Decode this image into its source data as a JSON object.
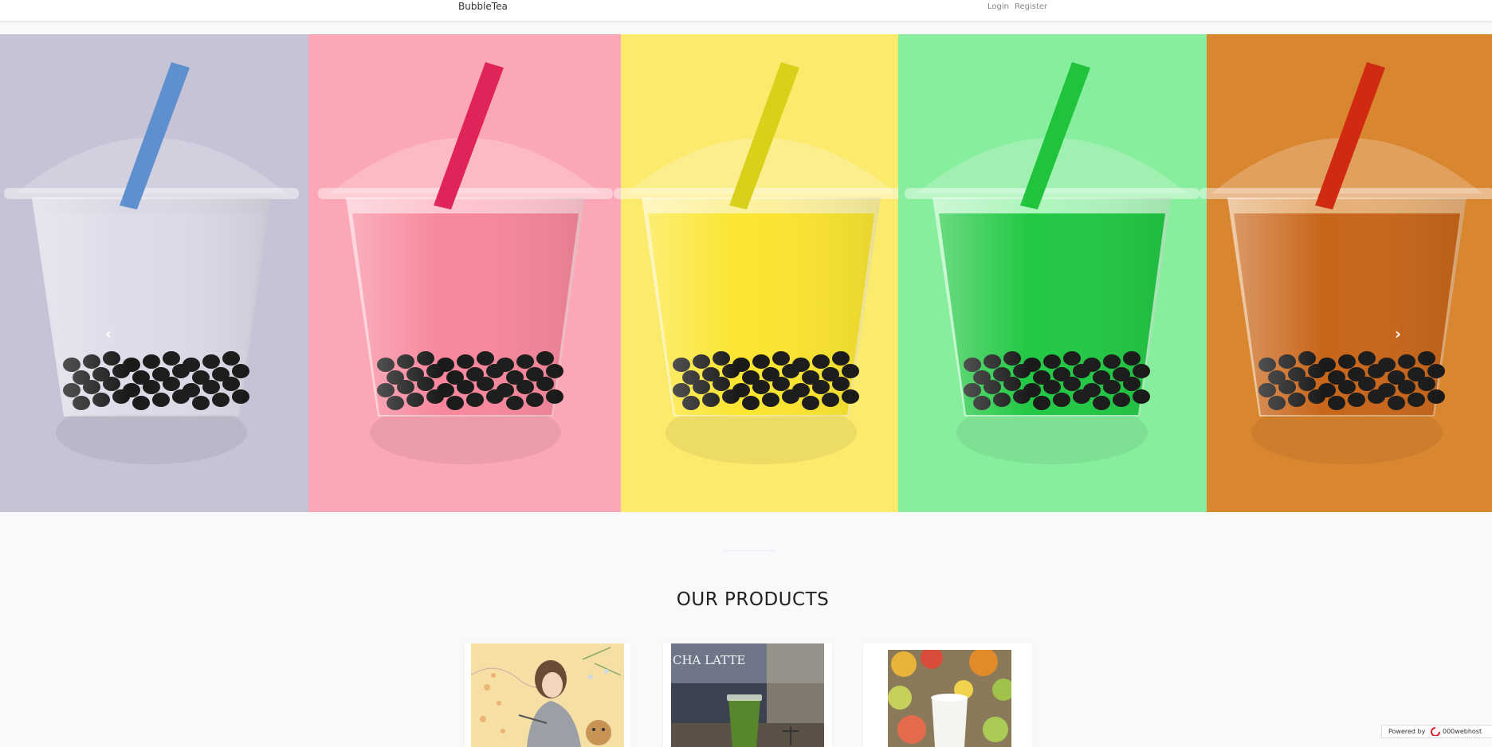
{
  "navbar": {
    "brand": "BubbleTea",
    "links": [
      {
        "label": "Login"
      },
      {
        "label": "Register"
      }
    ]
  },
  "carousel": {
    "prev_icon": "chevron-left-icon",
    "next_icon": "chevron-right-icon",
    "panels": [
      {
        "bg": "#c6c3d6",
        "drink": "#dcdbe8",
        "straw": "#5e8fcf"
      },
      {
        "bg": "#fca7b5",
        "drink": "#f7879c",
        "straw": "#e0245a"
      },
      {
        "bg": "#fbea6c",
        "drink": "#fbe530",
        "straw": "#d9d01a"
      },
      {
        "bg": "#86ee9c",
        "drink": "#22c844",
        "straw": "#1fc43c"
      },
      {
        "bg": "#d98630",
        "drink": "#c8661a",
        "straw": "#d02a10"
      }
    ]
  },
  "products": {
    "title": "OUR PRODUCTS",
    "items": [
      {
        "caption": ""
      },
      {
        "caption": "CHA LATTE"
      },
      {
        "caption": ""
      }
    ]
  },
  "badge": {
    "powered": "Powered by",
    "host": "000webhost"
  }
}
